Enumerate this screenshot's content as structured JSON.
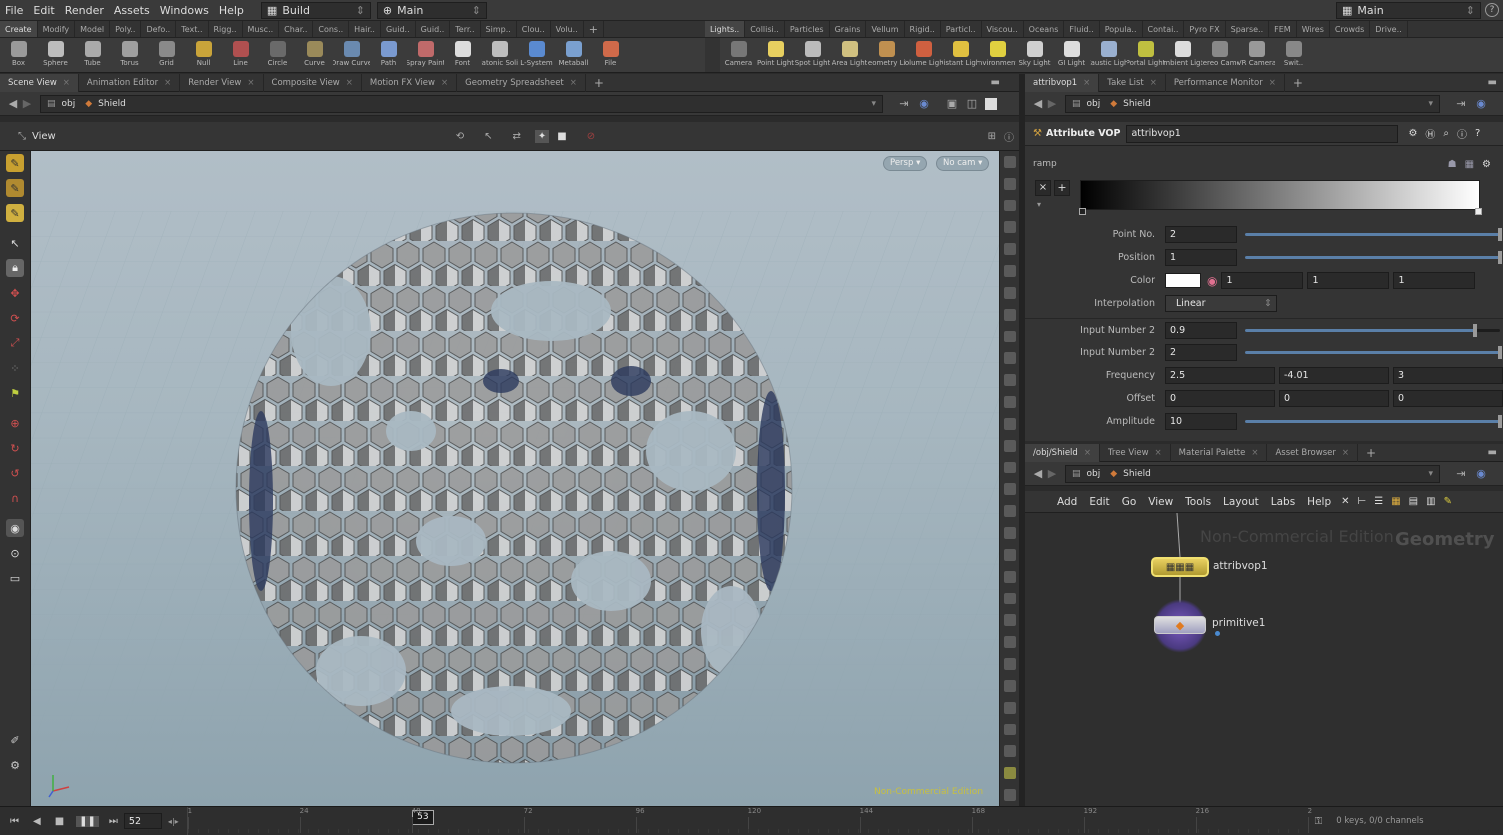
{
  "menubar": {
    "items": [
      "File",
      "Edit",
      "Render",
      "Assets",
      "Windows",
      "Help"
    ],
    "desktop_build": "Build",
    "desktop_main": "Main",
    "right_main": "Main"
  },
  "shelf_left": {
    "tabs": [
      "Create",
      "Modify",
      "Model",
      "Poly..",
      "Defo..",
      "Text..",
      "Rigg..",
      "Musc..",
      "Char..",
      "Cons..",
      "Hair..",
      "Guid..",
      "Guid..",
      "Terr..",
      "Simp..",
      "Clou..",
      "Volu.."
    ],
    "active": 0
  },
  "shelf_right": {
    "tabs": [
      "Lights..",
      "Collisi..",
      "Particles",
      "Grains",
      "Vellum",
      "Rigid..",
      "Particl..",
      "Viscou..",
      "Oceans",
      "Fluid..",
      "Popula..",
      "Contai..",
      "Pyro FX",
      "Sparse..",
      "FEM",
      "Wires",
      "Crowds",
      "Drive.."
    ],
    "active": 0
  },
  "tools_left": [
    {
      "label": "Box",
      "color": "#9a9a9a"
    },
    {
      "label": "Sphere",
      "color": "#bdbdbd"
    },
    {
      "label": "Tube",
      "color": "#aaaaaa"
    },
    {
      "label": "Torus",
      "color": "#9f9f9f"
    },
    {
      "label": "Grid",
      "color": "#8a8a8a"
    },
    {
      "label": "Null",
      "color": "#c9a43a"
    },
    {
      "label": "Line",
      "color": "#b05050"
    },
    {
      "label": "Circle",
      "color": "#6a6a6a"
    },
    {
      "label": "Curve",
      "color": "#9a8a5a"
    },
    {
      "label": "Draw Curve",
      "color": "#6a8ab0"
    },
    {
      "label": "Path",
      "color": "#7a9ad0"
    },
    {
      "label": "Spray Paint",
      "color": "#c06a6a"
    },
    {
      "label": "Font",
      "color": "#dddddd"
    },
    {
      "label": "Platonic Solids",
      "color": "#bdbdbd"
    },
    {
      "label": "L-System",
      "color": "#5a8ad0"
    },
    {
      "label": "Metaball",
      "color": "#7aa0d0"
    },
    {
      "label": "File",
      "color": "#d06a4a"
    }
  ],
  "tools_right": [
    {
      "label": "Camera",
      "color": "#777777"
    },
    {
      "label": "Point Light",
      "color": "#e8d060"
    },
    {
      "label": "Spot Light",
      "color": "#bbbbbb"
    },
    {
      "label": "Area Light",
      "color": "#d0c080"
    },
    {
      "label": "Geometry Light",
      "color": "#c09050"
    },
    {
      "label": "Volume Light",
      "color": "#d06040"
    },
    {
      "label": "Distant Light",
      "color": "#e0c040"
    },
    {
      "label": "Environment Light",
      "color": "#e0d040"
    },
    {
      "label": "Sky Light",
      "color": "#d0d0d0"
    },
    {
      "label": "GI Light",
      "color": "#dddddd"
    },
    {
      "label": "Caustic Light",
      "color": "#9ab0d0"
    },
    {
      "label": "Portal Light",
      "color": "#c0c040"
    },
    {
      "label": "Ambient Light",
      "color": "#dddddd"
    },
    {
      "label": "Stereo Camera",
      "color": "#888888"
    },
    {
      "label": "VR Camera",
      "color": "#999999"
    },
    {
      "label": "Swit..",
      "color": "#888888"
    }
  ],
  "left_pane": {
    "tabs": [
      "Scene View",
      "Animation Editor",
      "Render View",
      "Composite View",
      "Motion FX View",
      "Geometry Spreadsheet"
    ],
    "path_obj": "obj",
    "path_node": "Shield",
    "view_label": "View",
    "persp": "Persp",
    "cam": "No cam",
    "watermark": "Non-Commercial Edition"
  },
  "timeline": {
    "frame": "52",
    "current": "53",
    "ticks": [
      "1",
      "24",
      "48",
      "72",
      "96",
      "120",
      "144",
      "168",
      "192",
      "216",
      "2"
    ],
    "current_fraction": 0.21,
    "keys_info": "0 keys, 0/0 channels"
  },
  "params": {
    "tabs": [
      "attribvop1",
      "Take List",
      "Performance Monitor"
    ],
    "path_obj": "obj",
    "path_node": "Shield",
    "node_type": "Attribute VOP",
    "node_name": "attribvop1",
    "ramp_label": "ramp",
    "rows": [
      {
        "label": "Point No.",
        "values": [
          "2"
        ],
        "slider": 1.0
      },
      {
        "label": "Position",
        "values": [
          "1"
        ],
        "slider": 1.0
      },
      {
        "label": "Color",
        "values": [
          "1",
          "1",
          "1"
        ]
      },
      {
        "label": "Interpolation",
        "values": [
          "Linear"
        ]
      },
      {
        "label": "Input Number 2",
        "values": [
          "0.9"
        ],
        "slider": 0.9
      },
      {
        "label": "Input Number 2",
        "values": [
          "2"
        ],
        "slider": 1.0
      },
      {
        "label": "Frequency",
        "values": [
          "2.5",
          "-4.01",
          "3"
        ]
      },
      {
        "label": "Offset",
        "values": [
          "0",
          "0",
          "0"
        ]
      },
      {
        "label": "Amplitude",
        "values": [
          "10"
        ],
        "slider": 1.0
      }
    ]
  },
  "network": {
    "tabs": [
      "/obj/Shield",
      "Tree View",
      "Material Palette",
      "Asset Browser"
    ],
    "path_obj": "obj",
    "path_node": "Shield",
    "menu": [
      "Add",
      "Edit",
      "Go",
      "View",
      "Tools",
      "Layout",
      "Labs",
      "Help"
    ],
    "watermark": "Non-Commercial Edition",
    "context": "Geometry",
    "nodes": [
      "attribvop1",
      "primitive1"
    ]
  }
}
